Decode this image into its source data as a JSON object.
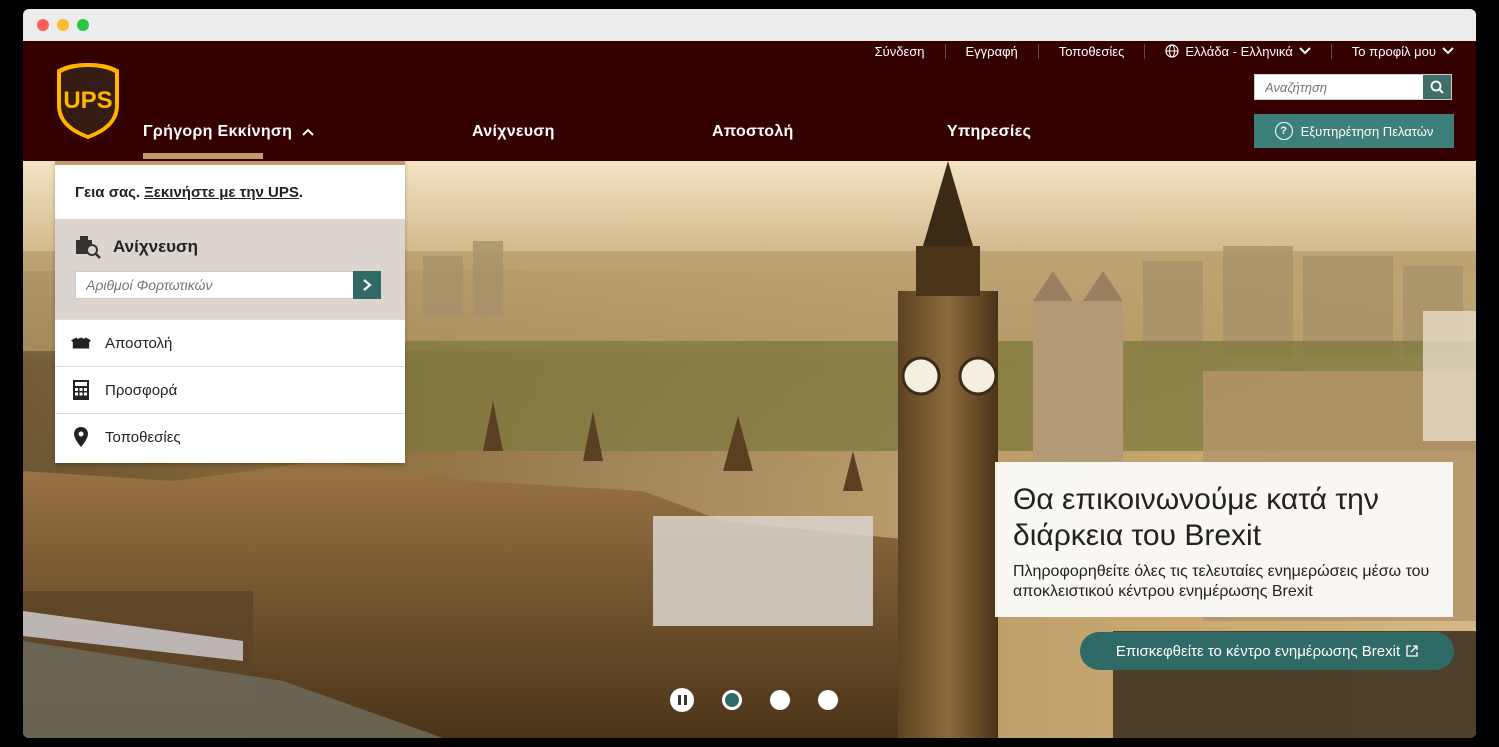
{
  "utility_nav": {
    "login": "Σύνδεση",
    "register": "Εγγραφή",
    "locations": "Τοποθεσίες",
    "region": "Ελλάδα - Ελληνικά",
    "profile": "Το προφίλ μου"
  },
  "search": {
    "placeholder": "Αναζήτηση"
  },
  "help_button": "Εξυπηρέτηση Πελατών",
  "main_nav": {
    "quick_start": "Γρήγορη Εκκίνηση",
    "tracking": "Ανίχνευση",
    "shipping": "Αποστολή",
    "services": "Υπηρεσίες"
  },
  "quick_panel": {
    "greeting_prefix": "Γεια σας.",
    "greeting_link": "Ξεκινήστε με την UPS",
    "greeting_suffix": ".",
    "tracking_title": "Ανίχνευση",
    "tracking_placeholder": "Αριθμοί Φορτωτικών",
    "links": [
      "Αποστολή",
      "Προσφορά",
      "Τοποθεσίες"
    ]
  },
  "promo": {
    "heading": "Θα επικοινωνούμε κατά την διάρκεια του Brexit",
    "body": "Πληροφορηθείτε όλες τις τελευταίες ενημερώσεις μέσω του αποκλειστικού κέντρου ενημέρωσης Brexit",
    "cta": "Επισκεφθείτε το κέντρο ενημέρωσης Brexit"
  },
  "logo_text": "UPS",
  "colors": {
    "header": "#350000",
    "accent": "#2f6a66",
    "gold": "#c59a6a"
  }
}
